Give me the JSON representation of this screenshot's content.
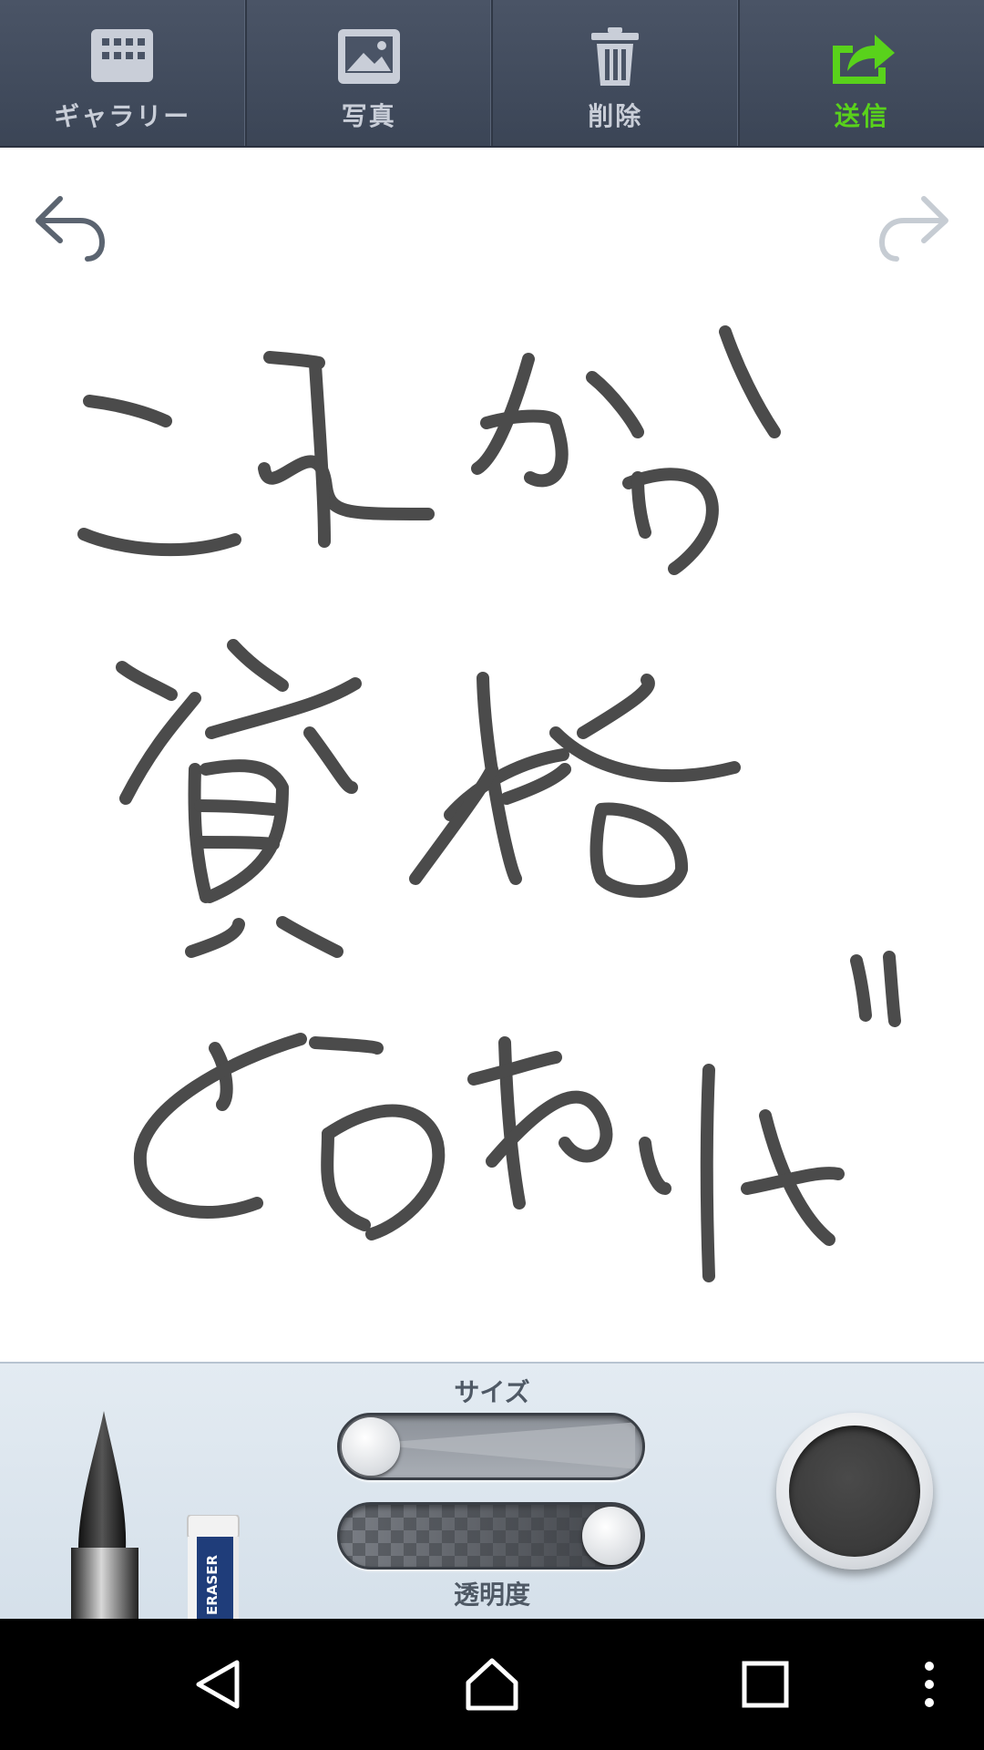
{
  "toolbar": {
    "items": [
      {
        "label": "ギャラリー",
        "icon": "gallery-grid-icon"
      },
      {
        "label": "写真",
        "icon": "photo-icon"
      },
      {
        "label": "削除",
        "icon": "trash-icon"
      },
      {
        "label": "送信",
        "icon": "share-icon"
      }
    ],
    "active_color": "#59d21b",
    "label_color": "#c9ced8"
  },
  "canvas": {
    "undo_icon": "undo-arrow-icon",
    "redo_icon": "redo-arrow-icon",
    "drawing_lines": [
      "これから",
      "資格",
      "とらねば"
    ]
  },
  "palette": {
    "size_label": "サイズ",
    "opacity_label": "透明度",
    "eraser_text": "ERASER",
    "size_level": 0.0,
    "opacity_level": 1.0,
    "selected_color": "#3a3a3a"
  },
  "navbar": {
    "icons": [
      "back-icon",
      "home-icon",
      "recent-apps-icon",
      "overflow-menu-icon"
    ]
  }
}
